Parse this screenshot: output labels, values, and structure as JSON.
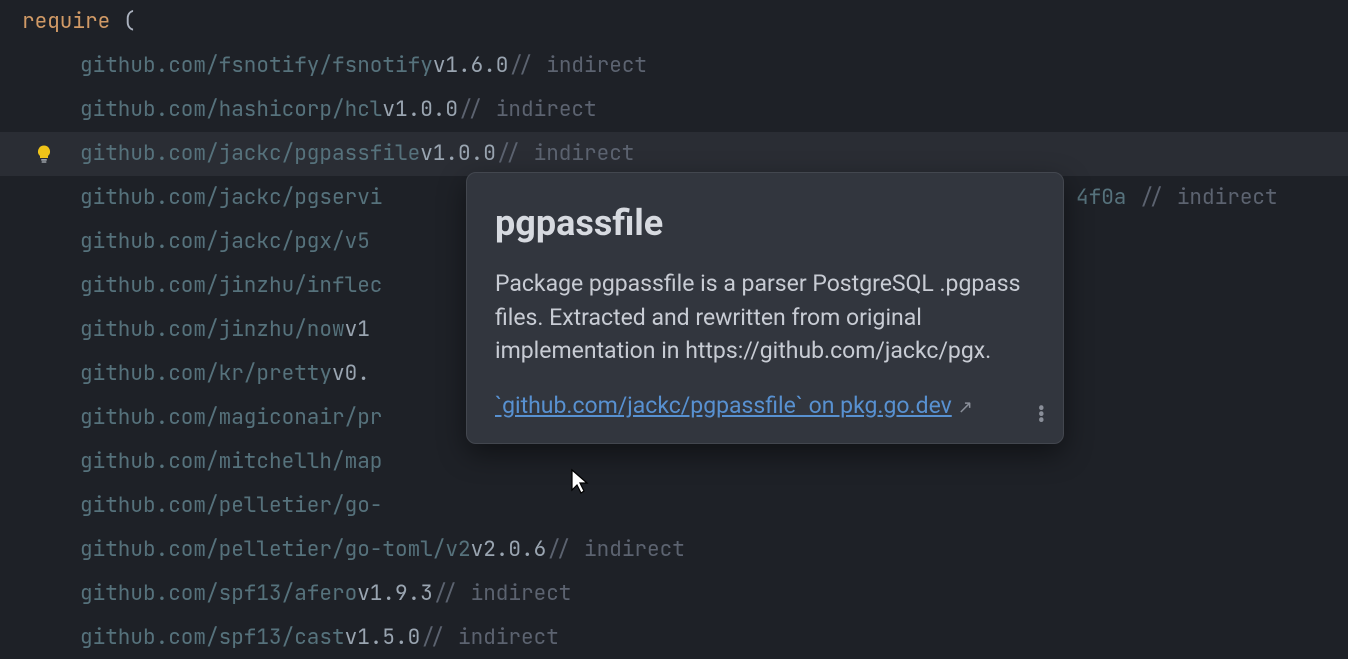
{
  "keyword": "require",
  "paren_open": "(",
  "lines": [
    {
      "module": "github.com/fsnotify/fsnotify",
      "version": "v1.6.0",
      "comment": "// indirect",
      "highlighted": false,
      "bulb": false
    },
    {
      "module": "github.com/hashicorp/hcl",
      "version": "v1.0.0",
      "comment": "// indirect",
      "highlighted": false,
      "bulb": false
    },
    {
      "module": "github.com/jackc/pgpassfile",
      "version": "v1.0.0",
      "comment": "// indirect",
      "highlighted": true,
      "bulb": true
    },
    {
      "module": "github.com/jackc/pgservi",
      "version": "",
      "version_tail": "4f0a // indirect",
      "comment": "",
      "highlighted": false,
      "bulb": false,
      "truncated": true
    },
    {
      "module": "github.com/jackc/pgx/v5",
      "version": "",
      "comment": "",
      "highlighted": false,
      "bulb": false
    },
    {
      "module": "github.com/jinzhu/inflec",
      "version": "",
      "comment": "",
      "highlighted": false,
      "bulb": false
    },
    {
      "module": "github.com/jinzhu/now",
      "version": "v1",
      "comment": "",
      "highlighted": false,
      "bulb": false
    },
    {
      "module": "github.com/kr/pretty",
      "version": "v0.",
      "comment": "",
      "highlighted": false,
      "bulb": false
    },
    {
      "module": "github.com/magiconair/pr",
      "version": "",
      "comment": "",
      "highlighted": false,
      "bulb": false
    },
    {
      "module": "github.com/mitchellh/map",
      "version": "",
      "comment": "",
      "highlighted": false,
      "bulb": false
    },
    {
      "module": "github.com/pelletier/go-",
      "version": "",
      "comment": "",
      "highlighted": false,
      "bulb": false
    },
    {
      "module": "github.com/pelletier/go-toml/v2",
      "version": "v2.0.6",
      "comment": "// indirect",
      "highlighted": false,
      "bulb": false
    },
    {
      "module": "github.com/spf13/afero",
      "version": "v1.9.3",
      "comment": "// indirect",
      "highlighted": false,
      "bulb": false
    },
    {
      "module": "github.com/spf13/cast",
      "version": "v1.5.0",
      "comment": "// indirect",
      "highlighted": false,
      "bulb": false
    }
  ],
  "tooltip": {
    "title": "pgpassfile",
    "body": "Package pgpassfile is a parser PostgreSQL .pgpass files. Extracted and rewritten from original implementation in https://github.com/jackc/pgx.",
    "link_text": "`github.com/jackc/pgpassfile` on pkg.go.dev",
    "external_icon": "↗"
  }
}
